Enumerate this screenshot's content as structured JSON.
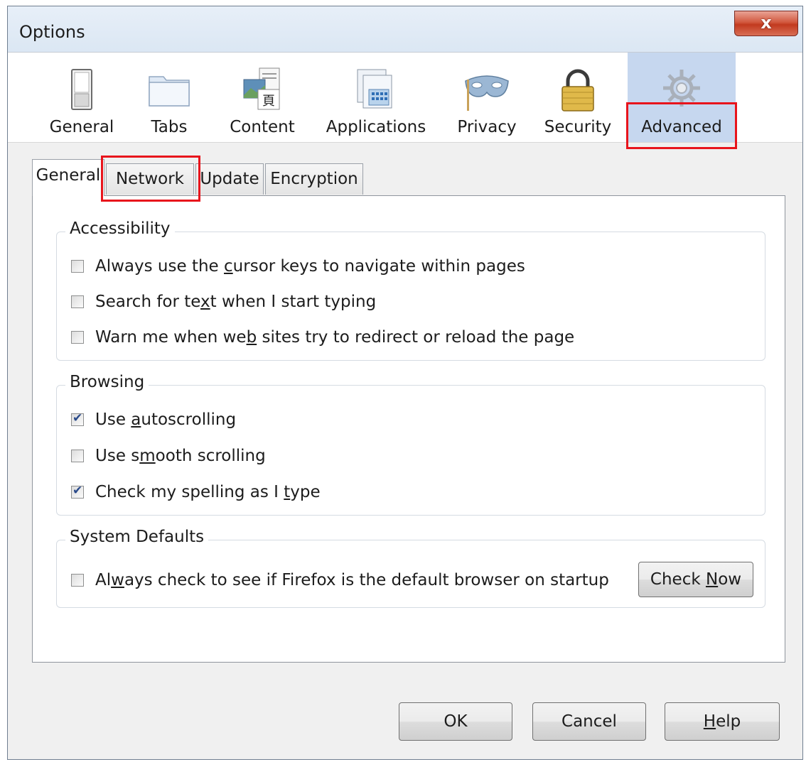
{
  "window": {
    "title": "Options",
    "close_label": "x"
  },
  "toolbar": {
    "panes": [
      {
        "label": "General",
        "icon": "general-switch-icon"
      },
      {
        "label": "Tabs",
        "icon": "tabs-folder-icon"
      },
      {
        "label": "Content",
        "icon": "content-page-icon"
      },
      {
        "label": "Applications",
        "icon": "applications-window-icon"
      },
      {
        "label": "Privacy",
        "icon": "privacy-mask-icon"
      },
      {
        "label": "Security",
        "icon": "security-padlock-icon"
      },
      {
        "label": "Advanced",
        "icon": "advanced-gear-icon",
        "selected": true
      }
    ]
  },
  "subtabs": [
    {
      "label": "General",
      "active": true
    },
    {
      "label": "Network",
      "active": false
    },
    {
      "label": "Update",
      "active": false
    },
    {
      "label": "Encryption",
      "active": false
    }
  ],
  "groups": {
    "accessibility": {
      "legend": "Accessibility",
      "options": [
        {
          "before": "Always use the ",
          "key": "c",
          "after": "ursor keys to navigate within pages",
          "checked": false
        },
        {
          "before": "Search for te",
          "key": "x",
          "after": "t when I start typing",
          "checked": false
        },
        {
          "before": "Warn me when we",
          "key": "b",
          "after": " sites try to redirect or reload the page",
          "checked": false
        }
      ]
    },
    "browsing": {
      "legend": "Browsing",
      "options": [
        {
          "before": "Use ",
          "key": "a",
          "after": "utoscrolling",
          "checked": true
        },
        {
          "before": "Use s",
          "key": "m",
          "after": "ooth scrolling",
          "checked": false
        },
        {
          "before": "Check my spelling as I ",
          "key": "t",
          "after": "ype",
          "checked": true
        }
      ]
    },
    "system_defaults": {
      "legend": "System Defaults",
      "options": [
        {
          "before": "Al",
          "key": "w",
          "after": "ays check to see if Firefox is the default browser on startup",
          "checked": false
        }
      ],
      "check_now": {
        "before": "Check ",
        "key": "N",
        "after": "ow"
      }
    }
  },
  "footer": {
    "ok": "OK",
    "cancel": "Cancel",
    "help": {
      "key": "H",
      "after": "elp"
    }
  },
  "colors": {
    "highlight": "#e8141c",
    "selected_pane": "#c6d7ef"
  }
}
